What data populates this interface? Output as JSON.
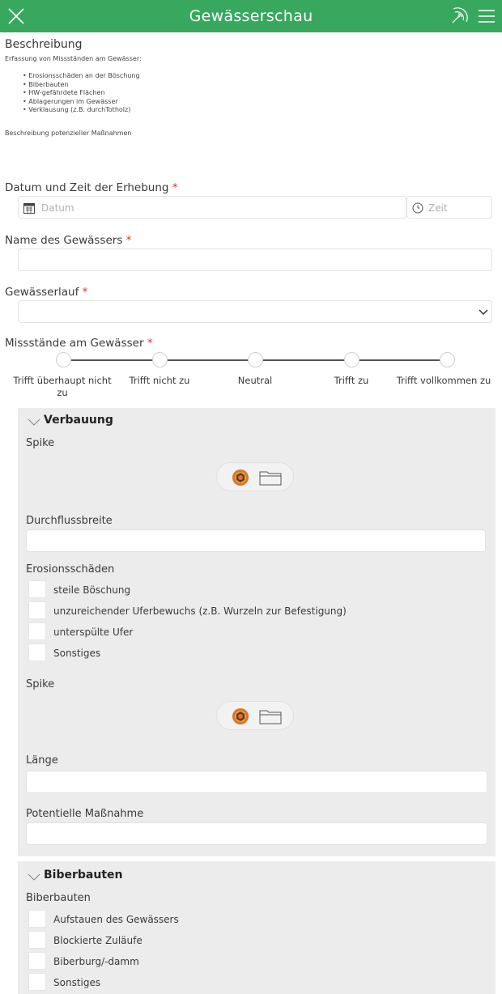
{
  "header": {
    "title": "Gewässerschau"
  },
  "description": {
    "title": "Beschreibung",
    "intro": "Erfassung von Missständen am Gewässer:",
    "items": [
      "Erosionsschäden an der Böschung",
      "Biberbauten",
      "HW-gefährdete Flächen",
      "Ablagerungen im Gewässer",
      "Verklausung (z.B. durchTotholz)"
    ],
    "footer": "Beschreibung potenzieller Maßnahmen"
  },
  "fields": {
    "datetime": {
      "label": "Datum und Zeit der Erhebung",
      "required": "*",
      "date_placeholder": "Datum",
      "time_placeholder": "Zeit"
    },
    "name": {
      "label": "Name des Gewässers",
      "required": "*"
    },
    "course": {
      "label": "Gewässerlauf",
      "required": "*"
    },
    "issues": {
      "label": "Missstände am Gewässer",
      "required": "*",
      "options": [
        "Trifft überhaupt nicht zu",
        "Trifft nicht zu",
        "Neutral",
        "Trifft zu",
        "Trifft vollkommen zu"
      ]
    }
  },
  "sections": {
    "verbauung": {
      "title": "Verbauung",
      "spike1": "Spike",
      "flow_width": "Durchflussbreite",
      "erosion": {
        "label": "Erosionsschäden",
        "options": [
          "steile Böschung",
          "unzureichender Uferbewuchs (z.B. Wurzeln zur Befestigung)",
          "unterspülte Ufer",
          "Sonstiges"
        ]
      },
      "spike2": "Spike",
      "length": "Länge",
      "measure": "Potentielle Maßnahme"
    },
    "biberbauten": {
      "title": "Biberbauten",
      "label": "Biberbauten",
      "options": [
        "Aufstauen des Gewässers",
        "Blockierte Zuläufe",
        "Biberburg/-damm",
        "Sonstiges"
      ]
    }
  },
  "colors": {
    "header": "#38a85f",
    "section_bg": "#ececec",
    "required": "#dd3333"
  }
}
